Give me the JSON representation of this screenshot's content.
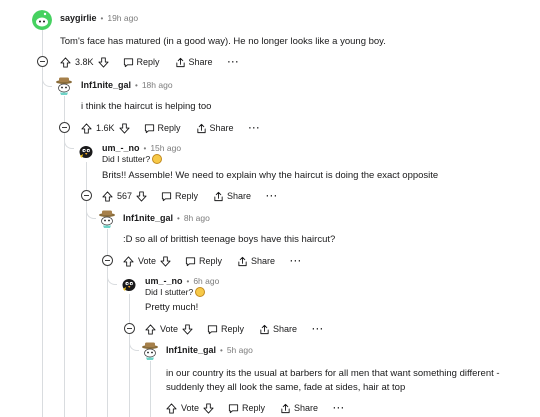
{
  "comments": [
    {
      "username": "saygirlie",
      "time": "19h ago",
      "text": "Tom's face has matured (in a good way). He no longer looks like a young boy.",
      "votes": "3.8K",
      "reply": "Reply",
      "share": "Share",
      "more": "···"
    },
    {
      "username": "Inf1nite_gal",
      "time": "18h ago",
      "text": "i think the haircut is helping too",
      "votes": "1.6K",
      "reply": "Reply",
      "share": "Share",
      "more": "···"
    },
    {
      "username": "um_-_no",
      "time": "15h ago",
      "flair": "Did I stutter?",
      "text": "Brits!! Assemble! We need to explain why the haircut is doing the exact opposite",
      "votes": "567",
      "reply": "Reply",
      "share": "Share",
      "more": "···"
    },
    {
      "username": "Inf1nite_gal",
      "time": "8h ago",
      "text": ":D so all of brittish teenage boys have this haircut?",
      "votes": "Vote",
      "reply": "Reply",
      "share": "Share",
      "more": "···"
    },
    {
      "username": "um_-_no",
      "time": "6h ago",
      "flair": "Did I stutter?",
      "text": "Pretty much!",
      "votes": "Vote",
      "reply": "Reply",
      "share": "Share",
      "more": "···"
    },
    {
      "username": "Inf1nite_gal",
      "time": "5h ago",
      "text_line1": "in our country its the usual at barbers for all men that want something different -",
      "text_line2": "suddenly they all look the same, fade at sides, hair at top",
      "votes": "Vote",
      "reply": "Reply",
      "share": "Share",
      "more": "···"
    }
  ],
  "icons": {
    "avatar_1": "green-snoo-avatar",
    "avatar_2": "hat-snoo-avatar",
    "avatar_3": "black-bird-avatar",
    "upvote": "arrow-up-icon",
    "downvote": "arrow-down-icon",
    "reply": "speech-bubble-icon",
    "share": "share-icon",
    "collapse": "collapse-minus-icon"
  },
  "colors": {
    "thread_line": "#d9dcdf",
    "meta_gray": "#7c7c7c",
    "text": "#1a1a1b"
  }
}
